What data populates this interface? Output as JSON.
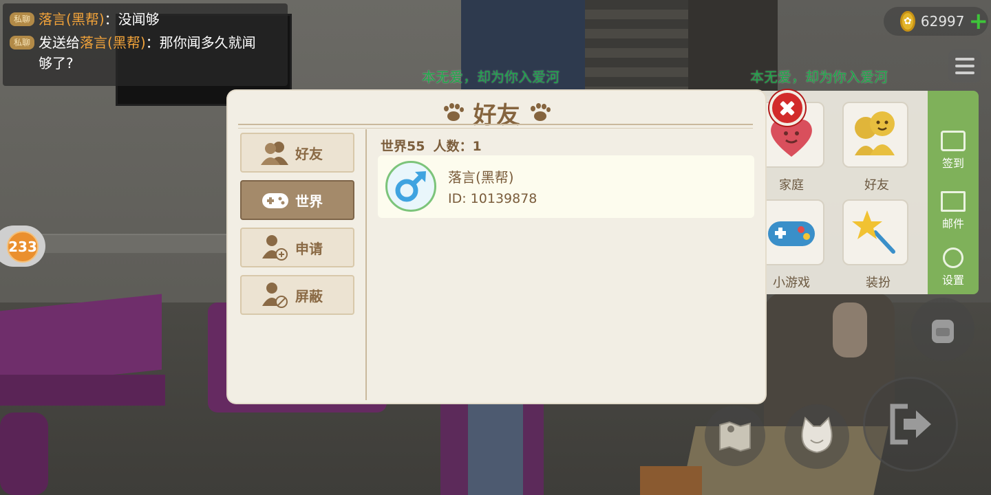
{
  "chat": {
    "lines": [
      {
        "tag": "私聊",
        "prefix": "",
        "name": "落言(黑帮)",
        "text": "：没闻够"
      },
      {
        "tag": "私聊",
        "prefix": "发送给",
        "name": "落言(黑帮)",
        "text": "：那你闻多久就闻够了?"
      }
    ]
  },
  "floating_names": [
    "本无爱，却为你入爱河",
    "本无爱，却为你入爱河"
  ],
  "coins": {
    "value": "62997",
    "plus": "+",
    "icon": "coin-icon"
  },
  "counter": "233",
  "side_menu": {
    "tiles": [
      {
        "label": "家庭",
        "icon": "heart-house-icon"
      },
      {
        "label": "好友",
        "icon": "friends-smiley-icon"
      },
      {
        "label": "小游戏",
        "icon": "gamepad-icon"
      },
      {
        "label": "装扮",
        "icon": "magic-wand-icon"
      }
    ],
    "green_items": [
      {
        "label": "签到",
        "icon": "checkin-icon"
      },
      {
        "label": "邮件",
        "icon": "mail-icon"
      },
      {
        "label": "设置",
        "icon": "gear-icon"
      }
    ]
  },
  "modal": {
    "title": "好友",
    "tabs": [
      {
        "label": "好友",
        "icon": "friends-icon",
        "active": false
      },
      {
        "label": "世界",
        "icon": "gamepad-icon",
        "active": true
      },
      {
        "label": "申请",
        "icon": "add-friend-icon",
        "active": false
      },
      {
        "label": "屏蔽",
        "icon": "block-user-icon",
        "active": false
      }
    ],
    "list_header": {
      "world": "世界55",
      "count": "人数：1"
    },
    "friends": [
      {
        "name": "落言(黑帮)",
        "id": "ID: 10139878",
        "gender_icon": "male-icon"
      }
    ]
  },
  "colors": {
    "accent_brown": "#85643e",
    "active_tab": "#a48a6a",
    "close_red": "#d22b2b",
    "male_blue": "#3fa3e0",
    "chat_orange": "#f0a23a",
    "name_green": "#1ea84a"
  }
}
